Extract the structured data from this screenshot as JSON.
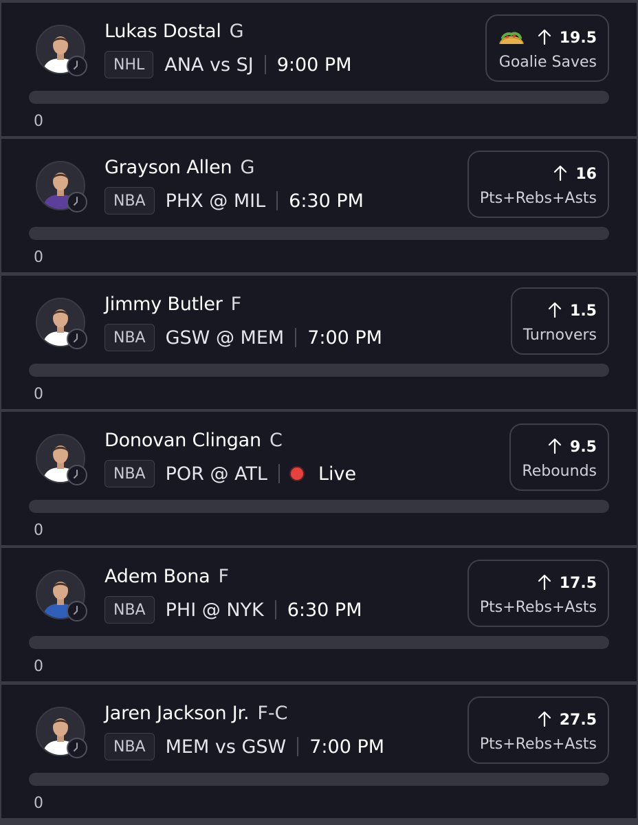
{
  "picks": [
    {
      "player": "Lukas Dostal",
      "position": "G",
      "league": "NHL",
      "matchup": "ANA vs SJ",
      "time": "9:00 PM",
      "live": false,
      "badge_icon": "taco-icon",
      "direction": "more",
      "line": "19.5",
      "stat": "Goalie Saves",
      "progress": 0,
      "progress_label": "0",
      "jersey_color": "#ffffff"
    },
    {
      "player": "Grayson Allen",
      "position": "G",
      "league": "NBA",
      "matchup": "PHX @ MIL",
      "time": "6:30 PM",
      "live": false,
      "badge_icon": "",
      "direction": "more",
      "line": "16",
      "stat": "Pts+Rebs+Asts",
      "progress": 0,
      "progress_label": "0",
      "jersey_color": "#5b3f9a"
    },
    {
      "player": "Jimmy Butler",
      "position": "F",
      "league": "NBA",
      "matchup": "GSW @ MEM",
      "time": "7:00 PM",
      "live": false,
      "badge_icon": "",
      "direction": "more",
      "line": "1.5",
      "stat": "Turnovers",
      "progress": 0,
      "progress_label": "0",
      "jersey_color": "#ffffff"
    },
    {
      "player": "Donovan Clingan",
      "position": "C",
      "league": "NBA",
      "matchup": "POR @ ATL",
      "time": "Live",
      "live": true,
      "live_color": "#e8403d",
      "badge_icon": "",
      "direction": "more",
      "line": "9.5",
      "stat": "Rebounds",
      "progress": 0,
      "progress_label": "0",
      "jersey_color": "#ffffff"
    },
    {
      "player": "Adem Bona",
      "position": "F",
      "league": "NBA",
      "matchup": "PHI @ NYK",
      "time": "6:30 PM",
      "live": false,
      "badge_icon": "",
      "direction": "more",
      "line": "17.5",
      "stat": "Pts+Rebs+Asts",
      "progress": 0,
      "progress_label": "0",
      "jersey_color": "#2f5fb8"
    },
    {
      "player": "Jaren Jackson Jr.",
      "position": "F-C",
      "league": "NBA",
      "matchup": "MEM vs GSW",
      "time": "7:00 PM",
      "live": false,
      "badge_icon": "",
      "direction": "more",
      "line": "27.5",
      "stat": "Pts+Rebs+Asts",
      "progress": 0,
      "progress_label": "0",
      "jersey_color": "#ffffff"
    }
  ],
  "colors": {
    "background": "#171821",
    "separator": "#3a3b45",
    "text": "#ffffff",
    "muted": "#cfd0d8",
    "track": "#35363f",
    "live": "#e8403d"
  }
}
